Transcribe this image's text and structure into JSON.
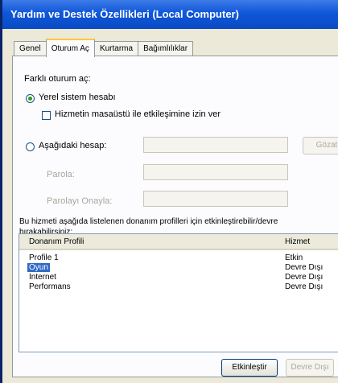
{
  "window": {
    "title": "Yardım ve Destek Özellikleri (Local Computer)"
  },
  "tabs": [
    "Genel",
    "Oturum Aç",
    "Kurtarma",
    "Bağımlılıklar"
  ],
  "logon": {
    "section_label": "Farklı oturum aç:",
    "local_system_label": "Yerel sistem hesabı",
    "desktop_checkbox_label": "Hizmetin masaüstü ile etkileşimine izin ver",
    "this_account_label": "Aşağıdaki hesap:",
    "browse_button": "Gözat",
    "password_label": "Parola:",
    "confirm_password_label": "Parolayı Onayla:"
  },
  "profiles": {
    "description_line1": "Bu hizmeti aşağıda listelenen donanım profilleri için etkinleştirebilir/devre",
    "description_line2": "bırakabilirsiniz:",
    "columns": [
      "Donanım Profili",
      "Hizmet"
    ],
    "rows": [
      {
        "profile": "Profile 1",
        "service": "Etkin"
      },
      {
        "profile": "Oyun",
        "service": "Devre Dışı"
      },
      {
        "profile": "Internet",
        "service": "Devre Dışı"
      },
      {
        "profile": "Performans",
        "service": "Devre Dışı"
      }
    ],
    "enable_button": "Etkinleştir",
    "disable_button": "Devre Dışı"
  },
  "colors": {
    "titlebar": "#0f56d9",
    "selection": "#316ac5",
    "tab_highlight": "#ffc83c"
  }
}
